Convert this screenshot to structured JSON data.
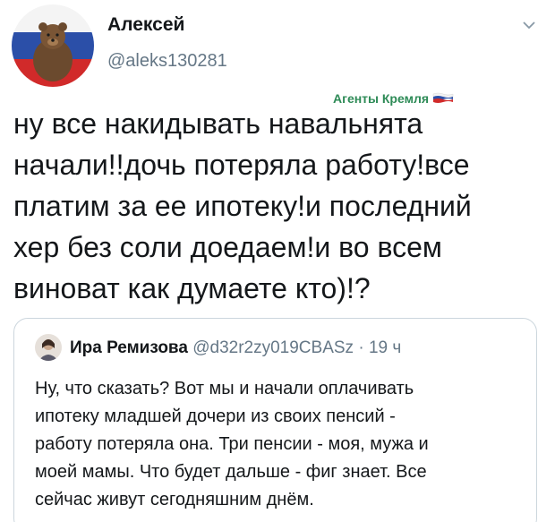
{
  "tweet": {
    "author_name": "Алексей",
    "author_handle": "@aleks130281",
    "badge_label": "Агенты Кремля",
    "text": "ну все накидывать навальнята\nначали!!дочь потеряла работу!все\nплатим за ее ипотеку!и последний\nхер без соли доедаем!и во всем\nвиноват как думаете кто)!?"
  },
  "quoted_tweet": {
    "author_name": "Ира Ремизова",
    "author_handle": "@d32r2zy019CBASz",
    "separator": "·",
    "time": "19 ч",
    "text": "Ну, что сказать? Вот мы и начали оплачивать\nипотеку младшей дочери из своих пенсий -\nработу потеряла она. Три пенсии - моя, мужа и\nмоей мамы. Что будет дальше - фиг знает. Все\nсейчас живут сегодняшним днём."
  },
  "icons": {
    "avatar": "bear-on-russian-flag-avatar",
    "menu": "chevron-down-icon",
    "badge": "russian-flag-icon"
  },
  "colors": {
    "handle": "#657786",
    "badge": "#2e8b57",
    "card_border": "#ccd6dd"
  }
}
